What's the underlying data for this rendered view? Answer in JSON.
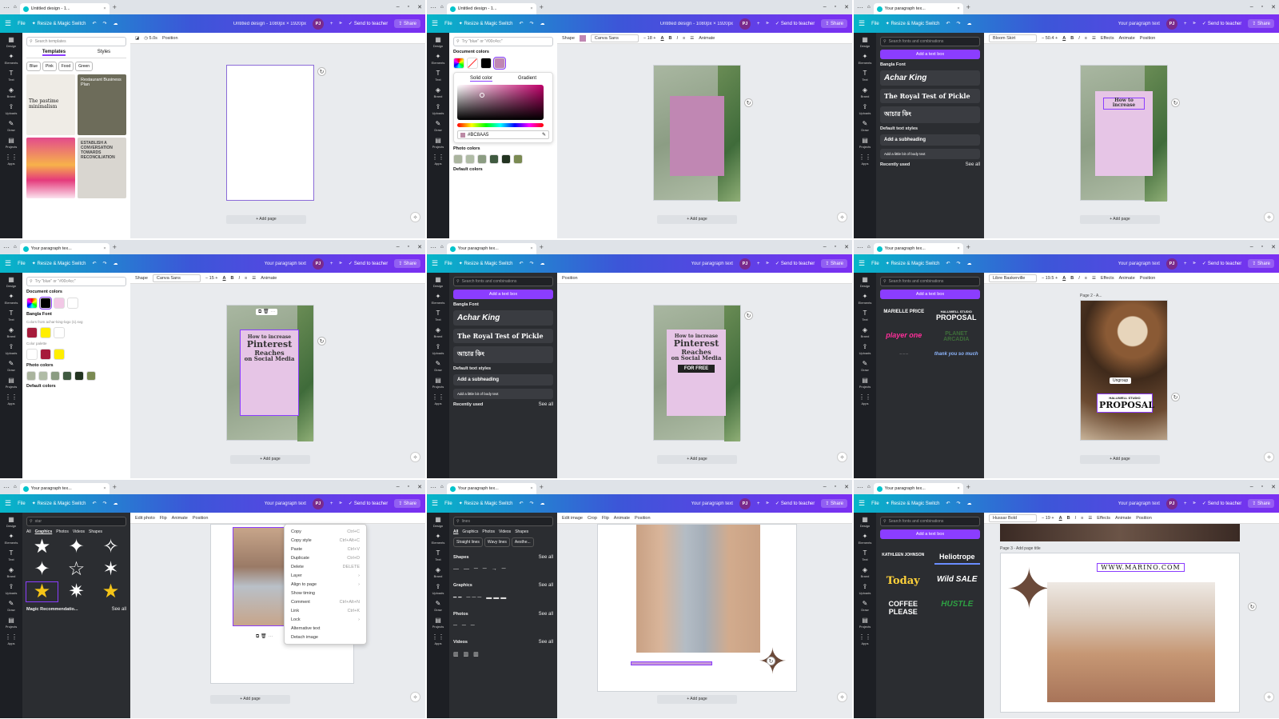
{
  "chrome": {
    "tab_untitled": "Untitled design - 1...",
    "tab_paragraph": "Your paragraph tex..."
  },
  "topbar": {
    "file": "File",
    "resize": "Resize & Magic Switch",
    "title_untitled": "Untitled design - 1080px × 1920px",
    "title_paragraph": "Your paragraph text",
    "avatar": "PJ",
    "send": "Send to teacher",
    "share": "Share"
  },
  "rail": [
    "Design",
    "Elements",
    "Text",
    "Brand",
    "Uploads",
    "Draw",
    "Projects",
    "Apps"
  ],
  "common": {
    "add_page": "+ Add page",
    "add_text_box": "Add a text box",
    "search_fonts": "Search fonts and combinations",
    "bangla_font": "Bangla Font",
    "achar": "Achar King",
    "royal": "The Royal Test of Pickle",
    "bangla_sample": "আচার কিং",
    "default_styles": "Default text styles",
    "subheading": "Add a subheading",
    "body": "Add a little bit of body text",
    "recent": "Recently used",
    "see_all": "See all",
    "position": "Position",
    "animate": "Animate",
    "effects": "Effects",
    "shape": "Shape"
  },
  "p1": {
    "search": "Search templates",
    "tab_templates": "Templates",
    "tab_styles": "Styles",
    "chips": [
      "Blue",
      "Pink",
      "Food",
      "Green"
    ],
    "tpl1": "The pastime minimalism",
    "tpl2": "Restaurant Business Plan",
    "tpl4": "ESTABLISH A CONVERSATION TOWARDS RECONCILIATION",
    "time": "5.0s"
  },
  "p2": {
    "search": "Try \"blue\" or \"#00c4cc\"",
    "doc_colors": "Document colors",
    "solid": "Solid color",
    "gradient": "Gradient",
    "hex": "#BC8AA5",
    "photo_colors": "Photo colors",
    "default_colors": "Default colors",
    "font": "Canva Sans",
    "size": "18",
    "colors": {
      "mauve": "#c087b3",
      "black": "#000000",
      "pick": "#bc8aa5"
    }
  },
  "p3": {
    "font": "Bloom Skirt",
    "size": "50.4",
    "canvas_text": "How to increase"
  },
  "p4": {
    "font": "Canva Sans",
    "size": "15",
    "brand_caption": "Colors from achar-king-logo (1).svg",
    "color_palette": "Color palette",
    "lines": [
      "How to increase",
      "Pinterest",
      "Reaches",
      "on Social Media"
    ]
  },
  "p5": {
    "for_free": "FOR FREE"
  },
  "p6": {
    "font": "Libre Baskerville",
    "size": "19.5",
    "page_label": "Page 2 - A...",
    "ungroup": "Ungroup",
    "studio": "HALLIWELL STUDIO",
    "proposal": "PROPOSAL",
    "marielle": "MARIELLE PRICE",
    "player": "player one",
    "planet": "PLANET ARCADIA",
    "thanks": "thank you so much"
  },
  "p7": {
    "search": "star",
    "filters": [
      "All",
      "Graphics",
      "Photos",
      "Videos",
      "Shapes"
    ],
    "magic": "Magic Recommendatio...",
    "toolbar": [
      "Edit photo",
      "Flip",
      "Animate",
      "Position"
    ],
    "menu": [
      {
        "l": "Copy",
        "k": "Ctrl+C"
      },
      {
        "l": "Copy style",
        "k": "Ctrl+Alt+C"
      },
      {
        "l": "Paste",
        "k": "Ctrl+V"
      },
      {
        "l": "Duplicate",
        "k": "Ctrl+D"
      },
      {
        "l": "Delete",
        "k": "DELETE"
      },
      {
        "l": "Layer",
        "k": "›"
      },
      {
        "l": "Align to page",
        "k": "›"
      },
      {
        "l": "Show timing",
        "k": ""
      },
      {
        "l": "Comment",
        "k": "Ctrl+Alt+N"
      },
      {
        "l": "Link",
        "k": "Ctrl+K"
      },
      {
        "l": "Lock",
        "k": "›"
      },
      {
        "l": "Alternative text",
        "k": ""
      },
      {
        "l": "Detach image",
        "k": ""
      }
    ]
  },
  "p8": {
    "search": "lines",
    "filters": [
      "All",
      "Graphics",
      "Photos",
      "Videos",
      "Shapes"
    ],
    "chips": [
      "Straight lines",
      "Wavy lines",
      "Aesthe..."
    ],
    "shapes": "Shapes",
    "graphics": "Graphics",
    "photos": "Photos",
    "videos": "Videos",
    "toolbar": [
      "Edit image",
      "Crop",
      "Flip",
      "Animate",
      "Position"
    ]
  },
  "p9": {
    "font": "Hussar Bold",
    "size": "19",
    "page_label": "Page 3 - Add page title",
    "website": "WWW.MARINO.COM",
    "tiles": [
      "KATHLEEN JOHNSON",
      "Heliotrope",
      "Today",
      "Wild SALE",
      "COFFEE PLEASE",
      "HUSTLE"
    ]
  }
}
